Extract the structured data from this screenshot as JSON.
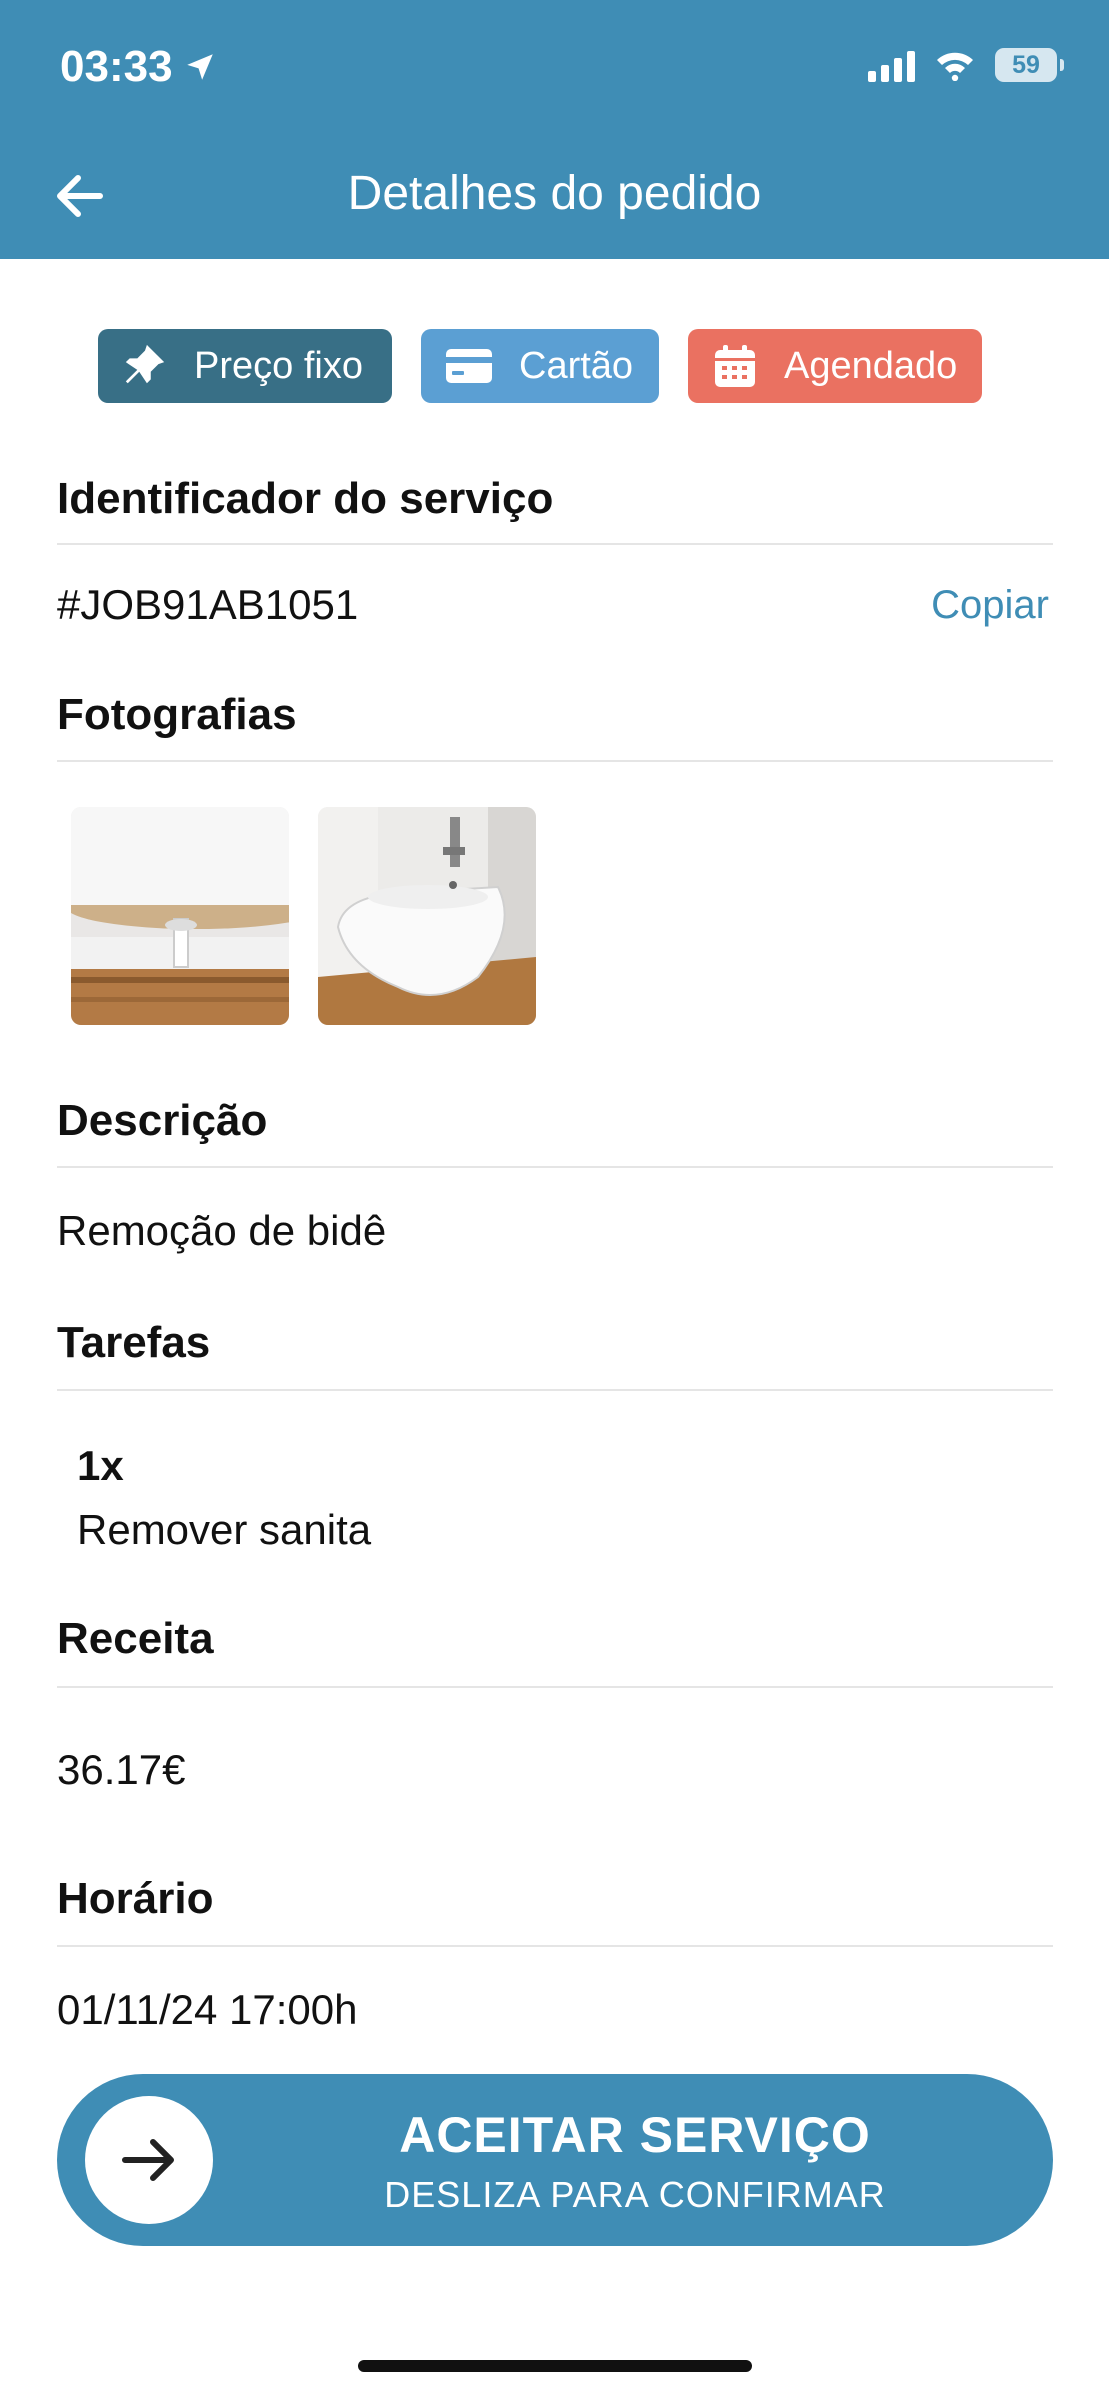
{
  "status_bar": {
    "time": "03:33",
    "battery": "59"
  },
  "header": {
    "title": "Detalhes do pedido"
  },
  "badges": [
    {
      "label": "Preço fixo",
      "icon": "pin-icon",
      "color": "#386f86"
    },
    {
      "label": "Cartão",
      "icon": "credit-card-icon",
      "color": "#5b9fd3"
    },
    {
      "label": "Agendado",
      "icon": "calendar-icon",
      "color": "#ea7161"
    }
  ],
  "service_id": {
    "title": "Identificador do serviço",
    "value": "#JOB91AB1051",
    "copy_label": "Copiar"
  },
  "photos": {
    "title": "Fotografias"
  },
  "description": {
    "title": "Descrição",
    "value": "Remoção de bidê"
  },
  "tasks": {
    "title": "Tarefas",
    "items": [
      {
        "quantity": "1x",
        "name": "Remover sanita"
      }
    ]
  },
  "revenue": {
    "title": "Receita",
    "value": "36.17€"
  },
  "schedule": {
    "title": "Horário",
    "value": "01/11/24 17:00h"
  },
  "accept": {
    "title": "ACEITAR SERVIÇO",
    "subtitle": "DESLIZA PARA CONFIRMAR"
  },
  "colors": {
    "primary": "#3f8db5"
  }
}
